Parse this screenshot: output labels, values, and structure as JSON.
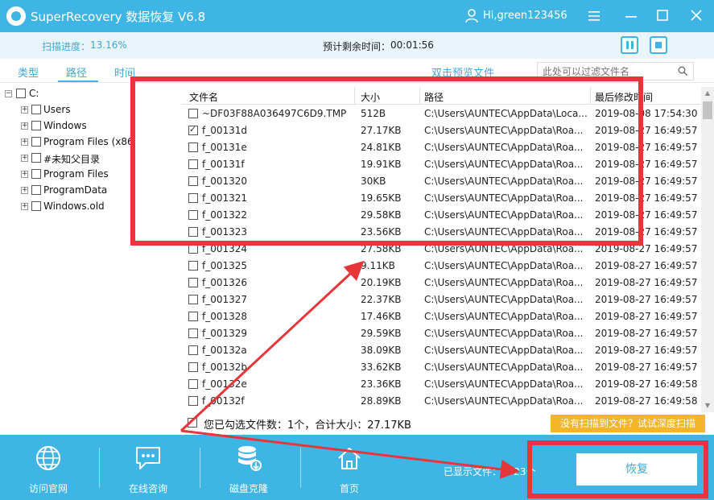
{
  "titlebar": {
    "title": "SuperRecovery 数据恢复 V6.8",
    "username": "Hi,green123456",
    "menu_icon": "hamburger-icon",
    "minimize_icon": "minimize-icon",
    "maximize_icon": "maximize-icon",
    "close_icon": "close-icon"
  },
  "progress": {
    "label": "扫描进度：",
    "value": "13.16%",
    "remaining_label": "预计剩余时间：",
    "remaining_value": "00:01:56"
  },
  "tabs": [
    {
      "label": "类型"
    },
    {
      "label": "路径"
    },
    {
      "label": "时间"
    }
  ],
  "preview_link": "双击预览文件",
  "search": {
    "placeholder": "此处可以过滤文件名"
  },
  "tree": {
    "root": "C:",
    "items": [
      {
        "label": "Users"
      },
      {
        "label": "Windows"
      },
      {
        "label": "Program Files (x86"
      },
      {
        "label": "#未知父目录"
      },
      {
        "label": "Program Files"
      },
      {
        "label": "ProgramData"
      },
      {
        "label": "Windows.old"
      }
    ]
  },
  "table": {
    "headers": [
      "文件名",
      "大小",
      "路径",
      "最后修改时间"
    ],
    "rows": [
      {
        "name": "~DF03F88A036497C6D9.TMP",
        "size": "512B",
        "path": "C:\\Users\\AUNTEC\\AppData\\Loca...",
        "time": "2019-08-08 17:54:30",
        "checked": false
      },
      {
        "name": "f_00131d",
        "size": "27.17KB",
        "path": "C:\\Users\\AUNTEC\\AppData\\Roa...",
        "time": "2019-08-27 16:49:57",
        "checked": true
      },
      {
        "name": "f_00131e",
        "size": "24.81KB",
        "path": "C:\\Users\\AUNTEC\\AppData\\Roa...",
        "time": "2019-08-27 16:49:57",
        "checked": false
      },
      {
        "name": "f_00131f",
        "size": "19.91KB",
        "path": "C:\\Users\\AUNTEC\\AppData\\Roa...",
        "time": "2019-08-27 16:49:57",
        "checked": false
      },
      {
        "name": "f_001320",
        "size": "30KB",
        "path": "C:\\Users\\AUNTEC\\AppData\\Roa...",
        "time": "2019-08-27 16:49:57",
        "checked": false
      },
      {
        "name": "f_001321",
        "size": "19.65KB",
        "path": "C:\\Users\\AUNTEC\\AppData\\Roa...",
        "time": "2019-08-27 16:49:57",
        "checked": false
      },
      {
        "name": "f_001322",
        "size": "29.58KB",
        "path": "C:\\Users\\AUNTEC\\AppData\\Roa...",
        "time": "2019-08-27 16:49:57",
        "checked": false
      },
      {
        "name": "f_001323",
        "size": "23.56KB",
        "path": "C:\\Users\\AUNTEC\\AppData\\Roa...",
        "time": "2019-08-27 16:49:57",
        "checked": false
      },
      {
        "name": "f_001324",
        "size": "27.58KB",
        "path": "C:\\Users\\AUNTEC\\AppData\\Roa...",
        "time": "2019-08-27 16:49:57",
        "checked": false
      },
      {
        "name": "f_001325",
        "size": "9.11KB",
        "path": "C:\\Users\\AUNTEC\\AppData\\Roa...",
        "time": "2019-08-27 16:49:57",
        "checked": false
      },
      {
        "name": "f_001326",
        "size": "20.19KB",
        "path": "C:\\Users\\AUNTEC\\AppData\\Roa...",
        "time": "2019-08-27 16:49:57",
        "checked": false
      },
      {
        "name": "f_001327",
        "size": "22.37KB",
        "path": "C:\\Users\\AUNTEC\\AppData\\Roa...",
        "time": "2019-08-27 16:49:57",
        "checked": false
      },
      {
        "name": "f_001328",
        "size": "17.46KB",
        "path": "C:\\Users\\AUNTEC\\AppData\\Roa...",
        "time": "2019-08-27 16:49:57",
        "checked": false
      },
      {
        "name": "f_001329",
        "size": "29.59KB",
        "path": "C:\\Users\\AUNTEC\\AppData\\Roa...",
        "time": "2019-08-27 16:49:57",
        "checked": false
      },
      {
        "name": "f_00132a",
        "size": "38.09KB",
        "path": "C:\\Users\\AUNTEC\\AppData\\Roa...",
        "time": "2019-08-27 16:49:57",
        "checked": false
      },
      {
        "name": "f_00132b",
        "size": "33.62KB",
        "path": "C:\\Users\\AUNTEC\\AppData\\Roa...",
        "time": "2019-08-27 16:49:57",
        "checked": false
      },
      {
        "name": "f_00132e",
        "size": "23.36KB",
        "path": "C:\\Users\\AUNTEC\\AppData\\Roa...",
        "time": "2019-08-27 16:49:58",
        "checked": false
      },
      {
        "name": "f_00132f",
        "size": "28.89KB",
        "path": "C:\\Users\\AUNTEC\\AppData\\Roa...",
        "time": "2019-08-27 16:49:58",
        "checked": false
      }
    ]
  },
  "summary": "您已勾选文件数：1个，合计大小：27.17KB",
  "deep_scan_button": "没有扫描到文件？试试深度扫描",
  "bottom_nav": [
    {
      "label": "访问官网",
      "icon": "globe-icon"
    },
    {
      "label": "在线咨询",
      "icon": "chat-icon"
    },
    {
      "label": "磁盘克隆",
      "icon": "database-icon"
    },
    {
      "label": "首页",
      "icon": "home-icon"
    }
  ],
  "shown_count": "已显示文件：1723个",
  "recover_button": "恢复",
  "colors": {
    "brand": "#3fb5e6",
    "accent_text": "#3fa8d8",
    "deep_scan": "#f5b52a",
    "annotation_red": "#e8353a"
  }
}
